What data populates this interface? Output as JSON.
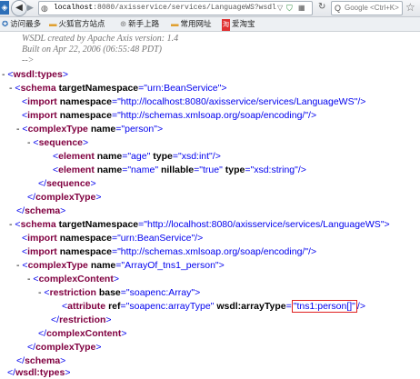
{
  "browser": {
    "url_host": "localhost",
    "url_rest": ":8080/axisservice/services/LanguageWS?wsdl",
    "search_placeholder": "Google <Ctrl+K>",
    "icons": {
      "back": "back-arrow-icon",
      "forward": "forward-arrow-icon",
      "reload": "reload-icon",
      "search": "search-icon",
      "star": "star-icon"
    }
  },
  "bookmarks": [
    {
      "label": "访问最多"
    },
    {
      "label": "火狐官方站点"
    },
    {
      "label": "新手上路"
    },
    {
      "label": "常用网址"
    },
    {
      "label": "爱淘宝"
    }
  ],
  "comment": [
    "WSDL created by Apache Axis version: 1.4",
    "Built on Apr 22, 2006 (06:55:48 PDT)",
    "-->"
  ],
  "xml": {
    "types_open": "wsdl:types",
    "types_close": "wsdl:types",
    "schema1": {
      "tag": "schema",
      "attr": "targetNamespace",
      "value": "urn:BeanService"
    },
    "import1a": {
      "tag": "import",
      "attr": "namespace",
      "value": "http://localhost:8080/axisservice/services/LanguageWS"
    },
    "import1b": {
      "tag": "import",
      "attr": "namespace",
      "value": "http://schemas.xmlsoap.org/soap/encoding/"
    },
    "ctype1": {
      "tag": "complexType",
      "attr": "name",
      "value": "person"
    },
    "sequence": "sequence",
    "el1": {
      "tag": "element",
      "a1": "name",
      "v1": "age",
      "a2": "type",
      "v2": "xsd:int"
    },
    "el2": {
      "tag": "element",
      "a1": "name",
      "v1": "name",
      "a2": "nillable",
      "v2": "true",
      "a3": "type",
      "v3": "xsd:string"
    },
    "sequence_close": "sequence",
    "ctype1_close": "complexType",
    "schema1_close": "schema",
    "schema2": {
      "tag": "schema",
      "attr": "targetNamespace",
      "value": "http://localhost:8080/axisservice/services/LanguageWS"
    },
    "import2a": {
      "tag": "import",
      "attr": "namespace",
      "value": "urn:BeanService"
    },
    "import2b": {
      "tag": "import",
      "attr": "namespace",
      "value": "http://schemas.xmlsoap.org/soap/encoding/"
    },
    "ctype2": {
      "tag": "complexType",
      "attr": "name",
      "value": "ArrayOf_tns1_person"
    },
    "ccontent": "complexContent",
    "restriction": {
      "tag": "restriction",
      "attr": "base",
      "value": "soapenc:Array"
    },
    "attribute": {
      "tag": "attribute",
      "a1": "ref",
      "v1": "soapenc:arrayType",
      "a2": "wsdl:arrayType",
      "v2": "tns1:person[]"
    },
    "restriction_close": "restriction",
    "ccontent_close": "complexContent",
    "ctype2_close": "complexType",
    "schema2_close": "schema"
  }
}
